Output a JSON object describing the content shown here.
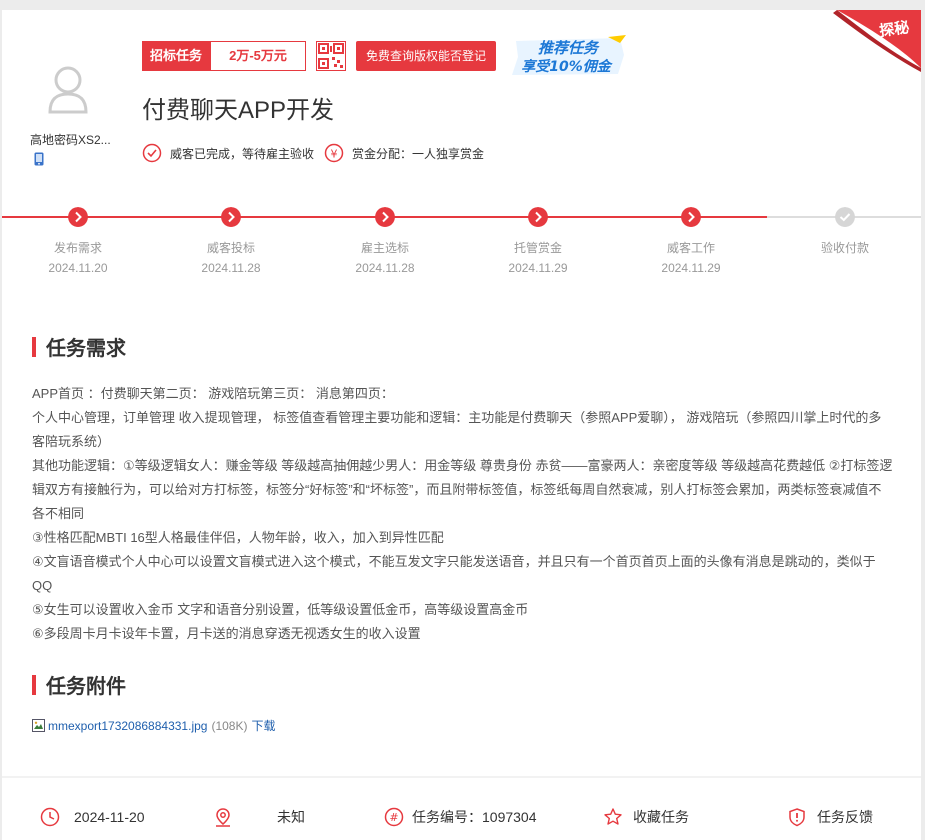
{
  "badge": {
    "corner_label": "探秘"
  },
  "user": {
    "name": "高地密码XS2..."
  },
  "tags": {
    "bid_label": "招标任务",
    "price": "2万-5万元",
    "copyright_button": "免费查询版权能否登记",
    "promo_line1": "推荐任务",
    "promo_line2": "享受10%佣金"
  },
  "task": {
    "title": "付费聊天APP开发",
    "status": "威客已完成，等待雇主验收",
    "reward_split": "赏金分配：一人独享赏金"
  },
  "progress": {
    "completed_steps": 5,
    "steps": [
      {
        "label": "发布需求",
        "date": "2024.11.20"
      },
      {
        "label": "威客投标",
        "date": "2024.11.28"
      },
      {
        "label": "雇主选标",
        "date": "2024.11.28"
      },
      {
        "label": "托管赏金",
        "date": "2024.11.29"
      },
      {
        "label": "威客工作",
        "date": "2024.11.29"
      },
      {
        "label": "验收付款",
        "date": ""
      }
    ]
  },
  "requirements": {
    "heading": "任务需求",
    "lines": [
      "APP首页 ：付费聊天第二页： 游戏陪玩第三页： 消息第四页：",
      " 个人中心管理，订单管理 收入提现管理， 标签值查看管理主要功能和逻辑：主功能是付费聊天（参照APP爱聊）， 游戏陪玩（参照四川掌上时代的多客陪玩系统）",
      "其他功能逻辑：①等级逻辑女人：赚金等级 等级越高抽佣越少男人：用金等级 尊贵身份 赤贫——富豪两人：亲密度等级 等级越高花费越低 ②打标签逻辑双方有接触行为，可以给对方打标签，标签分“好标签”和“坏标签”，而且附带标签值，标签纸每周自然衰减，别人打标签会累加，两类标签衰减值不各不相同",
      "③性格匹配MBTI 16型人格最佳伴侣，人物年龄，收入，加入到异性匹配",
      "④文盲语音模式个人中心可以设置文盲模式进入这个模式，不能互发文字只能发送语音，并且只有一个首页首页上面的头像有消息是跳动的，类似于QQ",
      "⑤女生可以设置收入金币 文字和语音分别设置，低等级设置低金币，高等级设置高金币",
      "⑥多段周卡月卡设年卡置，月卡送的消息穿透无视透女生的收入设置"
    ]
  },
  "attachments": {
    "heading": "任务附件",
    "file_name": "mmexport1732086884331.jpg",
    "file_size": "(108K)",
    "download_label": "下载"
  },
  "footer": {
    "date": "2024-11-20",
    "location": "未知",
    "task_number": "任务编号：1097304",
    "favorite_label": "收藏任务",
    "feedback_label": "任务反馈"
  },
  "colors": {
    "accent": "#e6393f",
    "link": "#1f5fad",
    "muted": "#999999"
  }
}
